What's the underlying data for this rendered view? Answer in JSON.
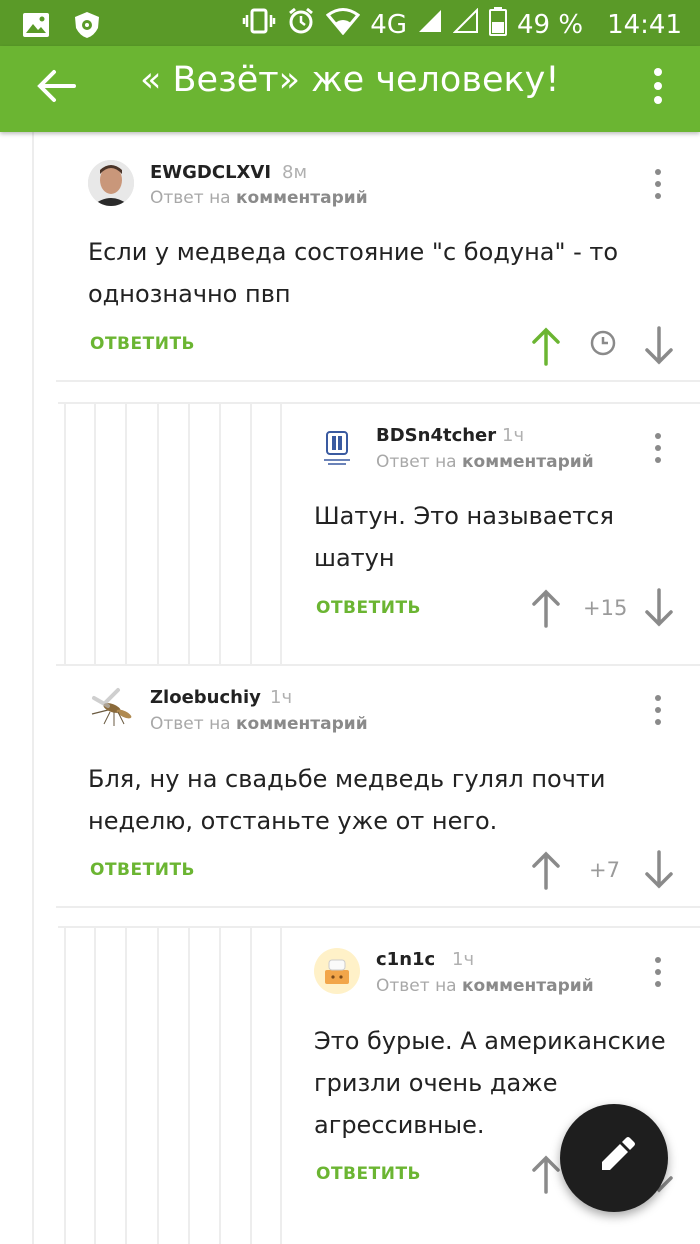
{
  "status_bar": {
    "network": "4G",
    "battery": "49 %",
    "time": "14:41"
  },
  "app_bar": {
    "title": "« Везёт» же человеку!"
  },
  "comments": [
    {
      "author": "EWGDCLXVI",
      "time": "8м",
      "reply_prefix": "Ответ на",
      "reply_target": "комментарий",
      "text_line1": "Если у медведа состояние \"с бодуна\" - то",
      "text_line2": "однозначно пвп",
      "reply_label": "ОТВЕТИТЬ",
      "score": ""
    },
    {
      "author": "BDSn4tcher",
      "time": "1ч",
      "reply_prefix": "Ответ на",
      "reply_target": "комментарий",
      "text_line1": "Шатун. Это называется",
      "text_line2": "шатун",
      "reply_label": "ОТВЕТИТЬ",
      "score": "+15"
    },
    {
      "author": "Zloebuchiy",
      "time": "1ч",
      "reply_prefix": "Ответ на",
      "reply_target": "комментарий",
      "text_line1": "Бля, ну на свадьбе медведь гулял почти",
      "text_line2": "неделю, отстаньте уже от него.",
      "reply_label": "ОТВЕТИТЬ",
      "score": "+7"
    },
    {
      "author": "c1n1c",
      "time": "1ч",
      "reply_prefix": "Ответ на",
      "reply_target": "комментарий",
      "text_line1": "Это бурые. А американские",
      "text_line2": "гризли очень даже",
      "text_line3": "агрессивные.",
      "reply_label": "ОТВЕТИТЬ",
      "score": ""
    }
  ],
  "colors": {
    "status_bar": "#5a9a28",
    "app_bar": "#6bb532",
    "accent_green": "#6bb532",
    "fab": "#1e1e1e"
  }
}
